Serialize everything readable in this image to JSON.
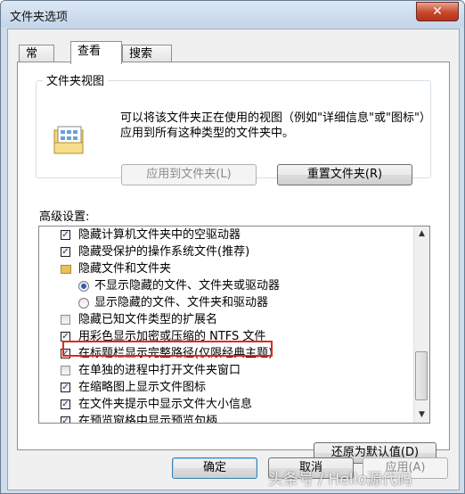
{
  "window": {
    "title": "文件夹选项",
    "close_label": "✕"
  },
  "tabs": [
    {
      "label": "常规"
    },
    {
      "label": "查看"
    },
    {
      "label": "搜索"
    }
  ],
  "folder_views": {
    "title": "文件夹视图",
    "description": "可以将该文件夹正在使用的视图（例如\"详细信息\"或\"图标\"）应用到所有这种类型的文件夹中。",
    "apply_button": "应用到文件夹(L)",
    "reset_button": "重置文件夹(R)"
  },
  "advanced": {
    "label": "高级设置:",
    "items": [
      {
        "type": "checkbox",
        "checked": true,
        "label": "隐藏计算机文件夹中的空驱动器"
      },
      {
        "type": "checkbox",
        "checked": true,
        "label": "隐藏受保护的操作系统文件(推荐)"
      },
      {
        "type": "folder",
        "label": "隐藏文件和文件夹"
      },
      {
        "type": "radio",
        "checked": true,
        "label": "不显示隐藏的文件、文件夹或驱动器"
      },
      {
        "type": "radio",
        "checked": false,
        "label": "显示隐藏的文件、文件夹和驱动器"
      },
      {
        "type": "checkbox",
        "checked": false,
        "label": "隐藏已知文件类型的扩展名"
      },
      {
        "type": "checkbox",
        "checked": true,
        "label": "用彩色显示加密或压缩的 NTFS 文件"
      },
      {
        "type": "checkbox",
        "checked": true,
        "label": "在标题栏显示完整路径(仅限经典主题)"
      },
      {
        "type": "checkbox",
        "checked": false,
        "label": "在单独的进程中打开文件夹窗口"
      },
      {
        "type": "checkbox",
        "checked": true,
        "label": "在缩略图上显示文件图标"
      },
      {
        "type": "checkbox",
        "checked": true,
        "label": "在文件夹提示中显示文件大小信息"
      },
      {
        "type": "checkbox",
        "checked": true,
        "label": "在预览窗格中显示预览句柄"
      }
    ],
    "restore_button": "还原为默认值(D)"
  },
  "footer": {
    "ok_button": "确定",
    "cancel_button": "取消",
    "apply_button": "应用(A)"
  },
  "watermark": "头条号 / Hello源代码",
  "colors": {
    "highlight": "#e0281f",
    "accent": "#2b62b5"
  }
}
